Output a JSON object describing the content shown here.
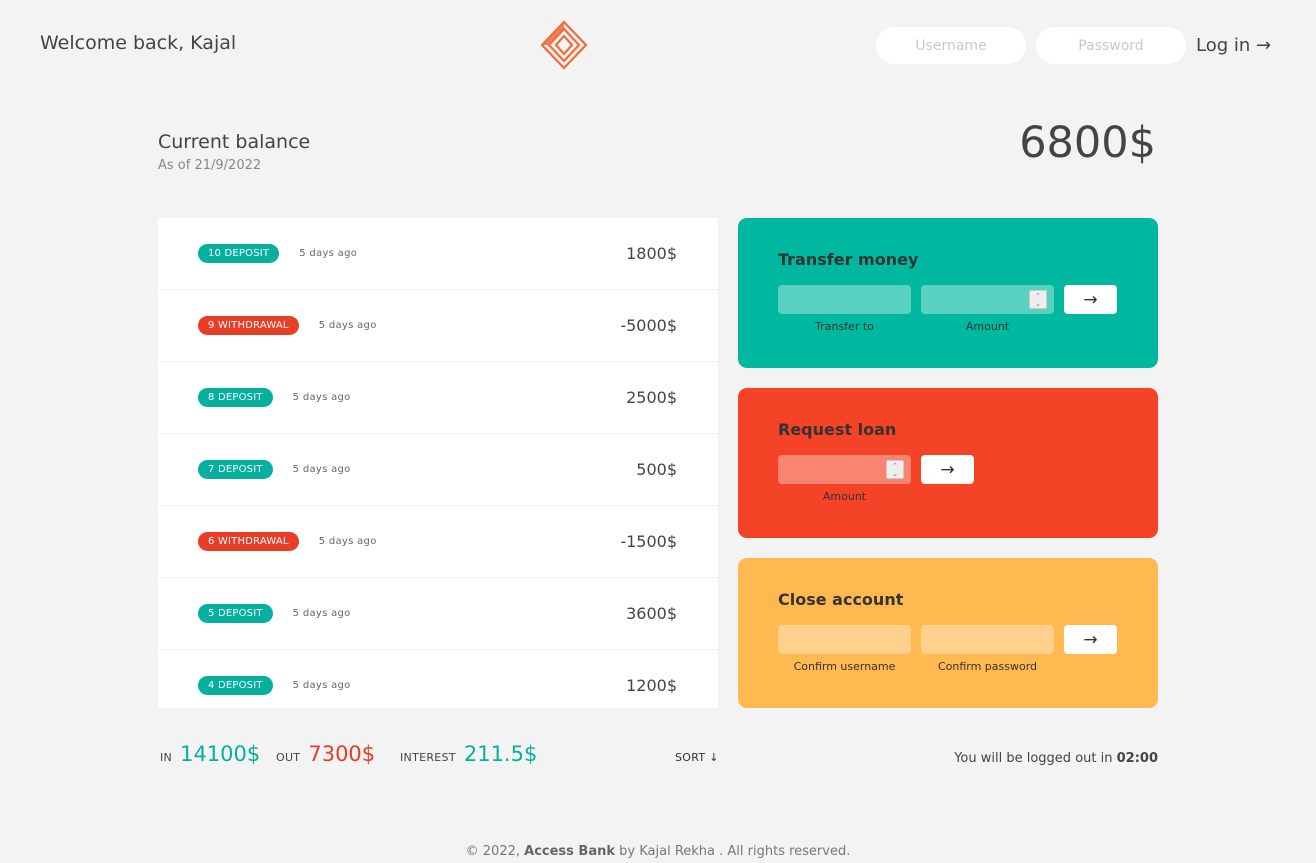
{
  "nav": {
    "welcome": "Welcome back, Kajal",
    "username_placeholder": "Username",
    "password_placeholder": "Password",
    "login_label": "Log in →"
  },
  "balance": {
    "label": "Current balance",
    "date_prefix": "As of ",
    "date": "21/9/2022",
    "value": "6800$"
  },
  "movements": [
    {
      "type": "deposit",
      "label": "10 deposit",
      "date": "5 days ago",
      "value": "1800$"
    },
    {
      "type": "withdrawal",
      "label": "9 withdrawal",
      "date": "5 days ago",
      "value": "-5000$"
    },
    {
      "type": "deposit",
      "label": "8 deposit",
      "date": "5 days ago",
      "value": "2500$"
    },
    {
      "type": "deposit",
      "label": "7 deposit",
      "date": "5 days ago",
      "value": "500$"
    },
    {
      "type": "withdrawal",
      "label": "6 withdrawal",
      "date": "5 days ago",
      "value": "-1500$"
    },
    {
      "type": "deposit",
      "label": "5 deposit",
      "date": "5 days ago",
      "value": "3600$"
    },
    {
      "type": "deposit",
      "label": "4 deposit",
      "date": "5 days ago",
      "value": "1200$"
    }
  ],
  "operations": {
    "transfer": {
      "title": "Transfer money",
      "to_label": "Transfer to",
      "amount_label": "Amount",
      "button": "→"
    },
    "loan": {
      "title": "Request loan",
      "amount_label": "Amount",
      "button": "→"
    },
    "close": {
      "title": "Close account",
      "user_label": "Confirm username",
      "pin_label": "Confirm password",
      "button": "→"
    }
  },
  "summary": {
    "in_label": "In",
    "in_value": "14100$",
    "out_label": "Out",
    "out_value": "7300$",
    "interest_label": "Interest",
    "interest_value": "211.5$",
    "sort_label": "SORT ↓"
  },
  "logout": {
    "text": "You will be logged out in ",
    "timer": "02:00"
  },
  "footer": {
    "copyright": "© 2022,",
    "brand": "Access Bank",
    "by": "by Kajal Rekha . All rights reserved."
  },
  "colors": {
    "deposit": "#06b09e",
    "withdrawal": "#e83d26",
    "transfer_bg": "#00b8a0",
    "loan_bg": "#f54327",
    "close_bg": "#ffb950",
    "logo": "#ef6d3b"
  },
  "icons": {
    "logo": "diamond-logo-icon"
  }
}
